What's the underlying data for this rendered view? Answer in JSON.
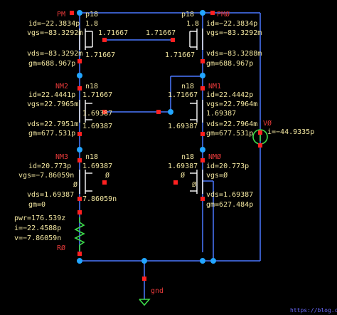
{
  "devices": {
    "pm_left": {
      "name": "PM",
      "model": "p18",
      "size": "1.8",
      "id": "id=−22.3834p",
      "vgs": "vgs=−83.3292m",
      "vds": "vds=−83.3292m",
      "gm": "gm=688.967p",
      "gate_v": "1.71667",
      "drain_v": "1.71667"
    },
    "pm_right": {
      "name": "PMØ",
      "model": "p18",
      "size": "1.8",
      "id": "id=−22.3834p",
      "vgs": "vgs=−83.3292m",
      "vds": "vds=−83.3288m",
      "gm": "gm=688.967p",
      "gate_v": "1.71667",
      "drain_v": "1.71667"
    },
    "nm2": {
      "name": "NM2",
      "model": "n18",
      "id": "id=22.4441p",
      "vgs": "vgs=22.7965m",
      "vds": "vds=22.7951m",
      "gm": "gm=677.531p",
      "v_top": "1.71667",
      "v_gate": "1.69387",
      "v_src": "1.69387"
    },
    "nm1": {
      "name": "NM1",
      "model": "n18",
      "id": "id=22.4442p",
      "vgs": "vgs=22.7964m",
      "vds": "vds=22.7964m",
      "gm": "gm=677.531p",
      "v_top": "1.71667",
      "v_gate": "1.69387",
      "v_src": "1.69387"
    },
    "nm3": {
      "name": "NM3",
      "model": "n18",
      "id": "id=20.773p",
      "vgs": "vgs=−7.86059n",
      "vds": "vds=1.69387",
      "gm": "gm=0",
      "v_top": "1.69387",
      "v_gate": "Ø",
      "v_src": "7.86059n",
      "v_body": "Ø"
    },
    "nm0": {
      "name": "NMØ",
      "model": "n18",
      "id": "id=20.773p",
      "vgs": "vgs=Ø",
      "vds": "vds=1.69387",
      "gm": "gm=627.484p",
      "v_top": "1.69387",
      "v_gate": "Ø",
      "v_body": "Ø"
    }
  },
  "resistor": {
    "name": "RØ",
    "pwr": "pwr=176.539z",
    "i": "i=−22.4588p",
    "v": "v=−7.86059n"
  },
  "source": {
    "name": "VØ",
    "i": "i=−44.9335p"
  },
  "ground": {
    "label": "gnd"
  },
  "watermark": "https://blog.csdn.net"
}
